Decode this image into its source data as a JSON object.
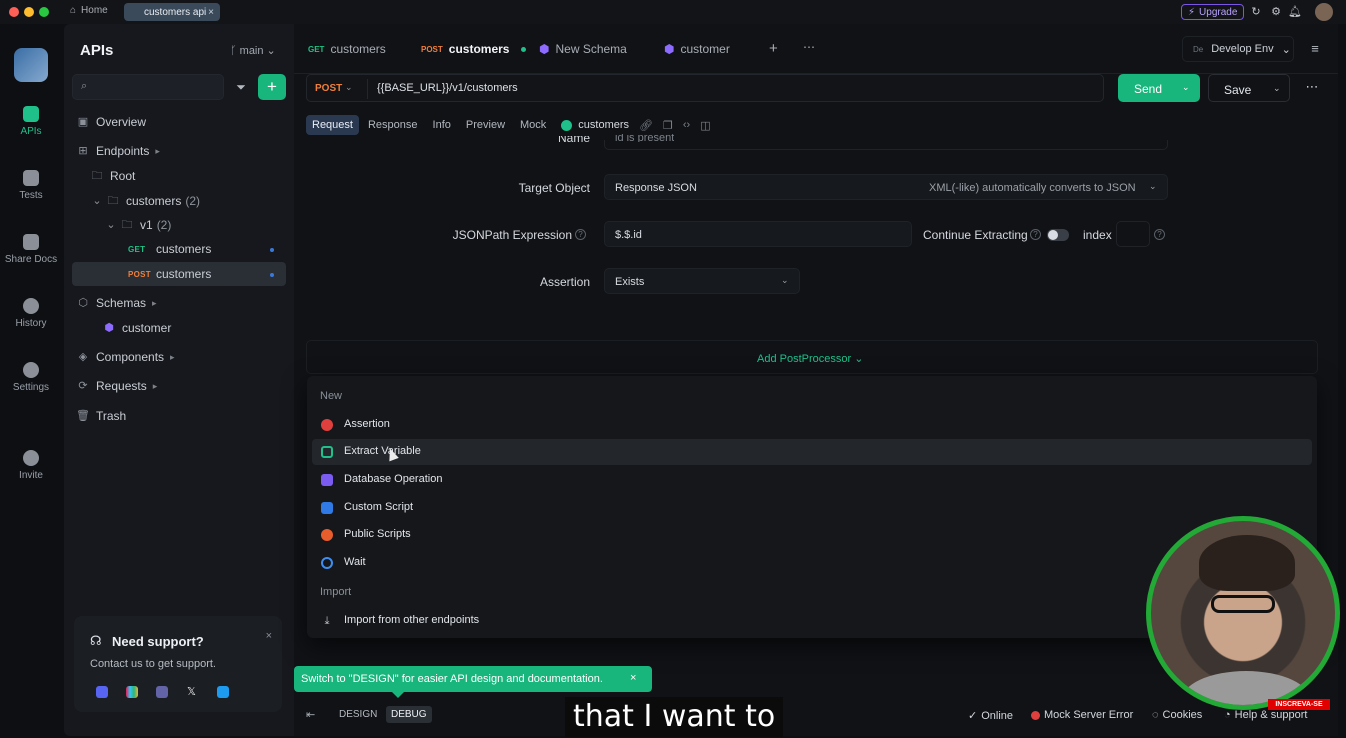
{
  "colors": {
    "accent": "#18b57d",
    "post": "#f07f3c",
    "get": "#20c184",
    "upgrade": "#7a55e6",
    "webcam_ring": "#23a936"
  },
  "titlebar": {
    "home_label": "Home",
    "tab_label": "customers api",
    "upgrade_label": "Upgrade"
  },
  "rail": {
    "items": [
      {
        "label": "APIs",
        "icon": "apis-icon"
      },
      {
        "label": "Tests",
        "icon": "tests-icon"
      },
      {
        "label": "Share Docs",
        "icon": "share-docs-icon"
      },
      {
        "label": "History",
        "icon": "history-icon"
      },
      {
        "label": "Settings",
        "icon": "settings-icon"
      },
      {
        "label": "Invite",
        "icon": "invite-icon"
      }
    ]
  },
  "sidebar": {
    "title": "APIs",
    "branch": "main",
    "overview": "Overview",
    "endpoints": "Endpoints",
    "root": "Root",
    "folder_customers": "customers",
    "folder_customers_count": "(2)",
    "folder_v1": "v1",
    "folder_v1_count": "(2)",
    "get_method": "GET",
    "get_name": "customers",
    "post_method": "POST",
    "post_name": "customers",
    "schemas": "Schemas",
    "schema_customer": "customer",
    "components": "Components",
    "requests": "Requests",
    "trash": "Trash",
    "support_title": "Need support?",
    "support_text": "Contact us to get support."
  },
  "tabs": [
    {
      "method": "GET",
      "label": "customers"
    },
    {
      "method": "POST",
      "label": "customers"
    },
    {
      "label": "New Schema"
    },
    {
      "label": "customer"
    }
  ],
  "env": {
    "badge": "De",
    "label": "Develop Env"
  },
  "request": {
    "method": "POST",
    "url": "{{BASE_URL}}/v1/customers",
    "send": "Send",
    "save": "Save"
  },
  "subtabs": [
    "Request",
    "Response",
    "Info",
    "Preview",
    "Mock"
  ],
  "subtab_endpoint": "customers",
  "form": {
    "name_label": "Name",
    "name_value": "id is present",
    "target_label": "Target Object",
    "target_value": "Response JSON",
    "target_hint": "XML(-like) automatically converts to JSON",
    "jsonpath_label": "JSONPath Expression",
    "jsonpath_value": "$.$.id",
    "continue_label": "Continue Extracting",
    "index_label": "index",
    "assertion_label": "Assertion",
    "assertion_value": "Exists"
  },
  "add_postprocessor": "Add PostProcessor",
  "menu": {
    "section_new": "New",
    "items": [
      "Assertion",
      "Extract Variable",
      "Database Operation",
      "Custom Script",
      "Public Scripts",
      "Wait"
    ],
    "section_import": "Import",
    "import_item": "Import from other endpoints"
  },
  "banner": "Switch to \"DESIGN\" for easier API design and documentation.",
  "bottom": {
    "design": "DESIGN",
    "debug": "DEBUG",
    "online": "Online",
    "mock_error": "Mock Server Error",
    "cookies": "Cookies",
    "help": "Help & support"
  },
  "caption": "that I want to",
  "overlay_badge": "INSCREVA-SE"
}
